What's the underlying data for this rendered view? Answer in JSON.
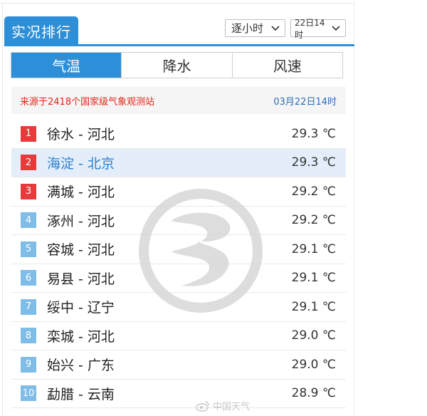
{
  "header": {
    "title": "实况排行"
  },
  "filters": {
    "interval": {
      "value": "逐小时"
    },
    "time": {
      "value": "22日14时"
    }
  },
  "tabs": [
    {
      "label": "气温",
      "active": true
    },
    {
      "label": "降水",
      "active": false
    },
    {
      "label": "风速",
      "active": false
    }
  ],
  "source": {
    "text": "来源于2418个国家级气象观测站",
    "time": "03月22日14时"
  },
  "ranking": [
    {
      "rank": "1",
      "city": "徐水 - 河北",
      "temp": "29.3 ℃"
    },
    {
      "rank": "2",
      "city": "海淀 - 北京",
      "temp": "29.3 ℃"
    },
    {
      "rank": "3",
      "city": "满城 - 河北",
      "temp": "29.2 ℃"
    },
    {
      "rank": "4",
      "city": "涿州 - 河北",
      "temp": "29.2 ℃"
    },
    {
      "rank": "5",
      "city": "容城 - 河北",
      "temp": "29.1 ℃"
    },
    {
      "rank": "6",
      "city": "易县 - 河北",
      "temp": "29.1 ℃"
    },
    {
      "rank": "7",
      "city": "绥中 - 辽宁",
      "temp": "29.1 ℃"
    },
    {
      "rank": "8",
      "city": "栾城 - 河北",
      "temp": "29.0 ℃"
    },
    {
      "rank": "9",
      "city": "始兴 - 广东",
      "temp": "29.0 ℃"
    },
    {
      "rank": "10",
      "city": "勐腊 - 云南",
      "temp": "28.9 ℃"
    }
  ],
  "colors": {
    "accent": "#2d8fd8",
    "rank_top": "#e63b3b",
    "rank_other": "#7fbde9",
    "source_text": "#e2261b",
    "source_time": "#2d6db5"
  },
  "watermark": {
    "text": "中国天气"
  }
}
